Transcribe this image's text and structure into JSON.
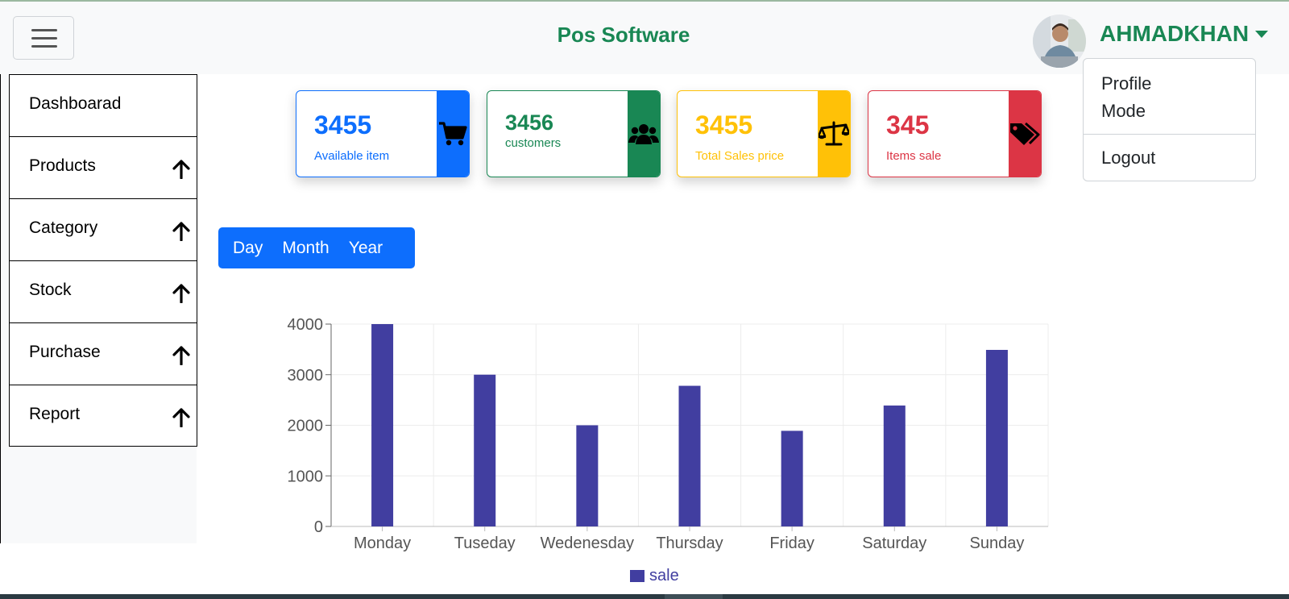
{
  "header": {
    "brand": "Pos Software",
    "username": "AHMADKHAN"
  },
  "user_menu": {
    "items": [
      "Profile",
      "Mode",
      "Logout"
    ]
  },
  "sidebar": {
    "items": [
      {
        "label": "Dashboarad",
        "has_arrow": false
      },
      {
        "label": "Products",
        "has_arrow": true
      },
      {
        "label": "Category",
        "has_arrow": true
      },
      {
        "label": "Stock",
        "has_arrow": true
      },
      {
        "label": "Purchase",
        "has_arrow": true
      },
      {
        "label": "Report",
        "has_arrow": true
      }
    ]
  },
  "cards": [
    {
      "value": "3455",
      "label": "Available item",
      "color": "#0d6efd",
      "icon": "cart-icon"
    },
    {
      "value": "3456",
      "label": "customers",
      "color": "#198754",
      "icon": "users-icon"
    },
    {
      "value": "3455",
      "label": "Total Sales price",
      "color": "#ffc107",
      "icon": "balance-scale-icon"
    },
    {
      "value": "345",
      "label": "Items sale",
      "color": "#dc3545",
      "icon": "tags-icon"
    }
  ],
  "periods": [
    "Day",
    "Month",
    "Year"
  ],
  "chart_data": {
    "type": "bar",
    "categories": [
      "Monday",
      "Tuseday",
      "Wedenesday",
      "Thursday",
      "Friday",
      "Saturday",
      "Sunday"
    ],
    "series": [
      {
        "name": "sale",
        "values": [
          4000,
          3000,
          2000,
          2780,
          1890,
          2390,
          3490
        ],
        "color": "#413ea0"
      }
    ],
    "ylim": [
      0,
      4000
    ],
    "yticks": [
      0,
      1000,
      2000,
      3000,
      4000
    ],
    "grid": true,
    "legend": "bottom"
  }
}
